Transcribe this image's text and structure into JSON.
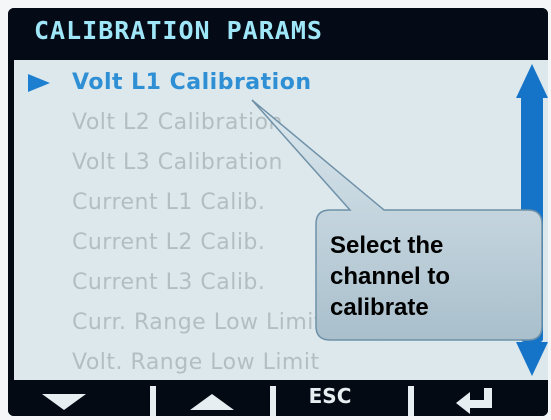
{
  "screen": {
    "title": "CALIBRATION PARAMS",
    "colors": {
      "background": "#040a14",
      "title_text": "#9fe7f8",
      "list_background": "#dde8ec",
      "selected_text": "#2e8fd4",
      "unselected_text": "#b3bec3",
      "scrollbar": "#1674c8"
    }
  },
  "menu": {
    "items": [
      {
        "label": "Volt L1 Calibration",
        "selected": true
      },
      {
        "label": "Volt L2 Calibration",
        "selected": false
      },
      {
        "label": "Volt L3 Calibration",
        "selected": false
      },
      {
        "label": "Current L1 Calib.",
        "selected": false
      },
      {
        "label": "Current L2 Calib.",
        "selected": false
      },
      {
        "label": "Current L3 Calib.",
        "selected": false
      },
      {
        "label": "Curr. Range Low Limit",
        "selected": false
      },
      {
        "label": "Volt. Range Low Limit",
        "selected": false
      }
    ],
    "selector_icon": "triangle-right-icon"
  },
  "scrollbar": {
    "up_icon": "arrow-up-icon",
    "down_icon": "arrow-down-icon"
  },
  "softkeys": {
    "down_icon": "triangle-down-icon",
    "up_icon": "triangle-up-icon",
    "esc_label": "ESC",
    "enter_icon": "enter-icon"
  },
  "callout": {
    "text_lines": [
      "Select the",
      "channel to",
      "calibrate"
    ]
  }
}
